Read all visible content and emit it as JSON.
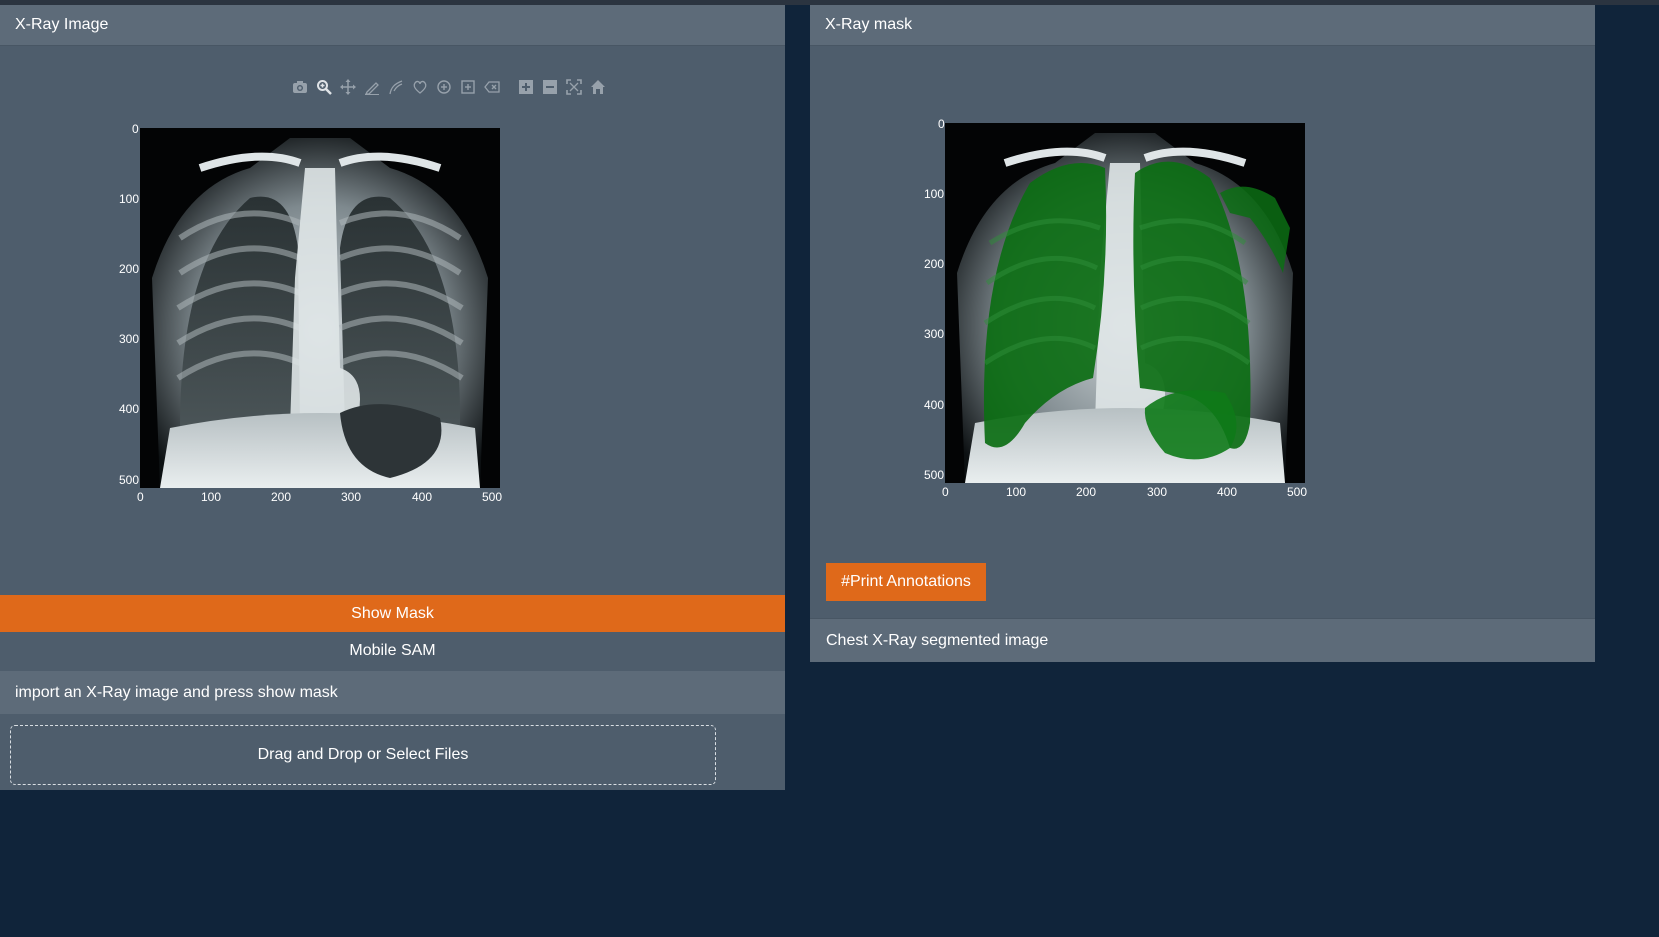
{
  "colors": {
    "accent": "#df691a",
    "panel": "#4e5d6c",
    "header": "#5d6b79",
    "background": "#10243a"
  },
  "left_panel": {
    "title": "X-Ray Image",
    "modebar_icons": [
      "camera-icon",
      "zoom-icon",
      "pan-icon",
      "draw-line-icon",
      "draw-open-path-icon",
      "draw-closed-path-icon",
      "draw-circle-icon",
      "draw-rect-icon",
      "erase-shape-icon",
      "zoom-in-icon",
      "zoom-out-icon",
      "autoscale-icon",
      "reset-axes-icon"
    ],
    "plot": {
      "x_ticks": [
        "0",
        "100",
        "200",
        "300",
        "400",
        "500"
      ],
      "y_ticks": [
        "0",
        "100",
        "200",
        "300",
        "400",
        "500"
      ]
    },
    "show_mask_label": "Show Mask",
    "model_label": "Mobile SAM",
    "instruction": "import an X-Ray image and press show mask",
    "upload_label": "Drag and Drop or Select Files"
  },
  "right_panel": {
    "title": "X-Ray mask",
    "plot": {
      "x_ticks": [
        "0",
        "100",
        "200",
        "300",
        "400",
        "500"
      ],
      "y_ticks": [
        "0",
        "100",
        "200",
        "300",
        "400",
        "500"
      ]
    },
    "print_button_label": "#Print Annotations",
    "caption": "Chest X-Ray segmented image"
  }
}
